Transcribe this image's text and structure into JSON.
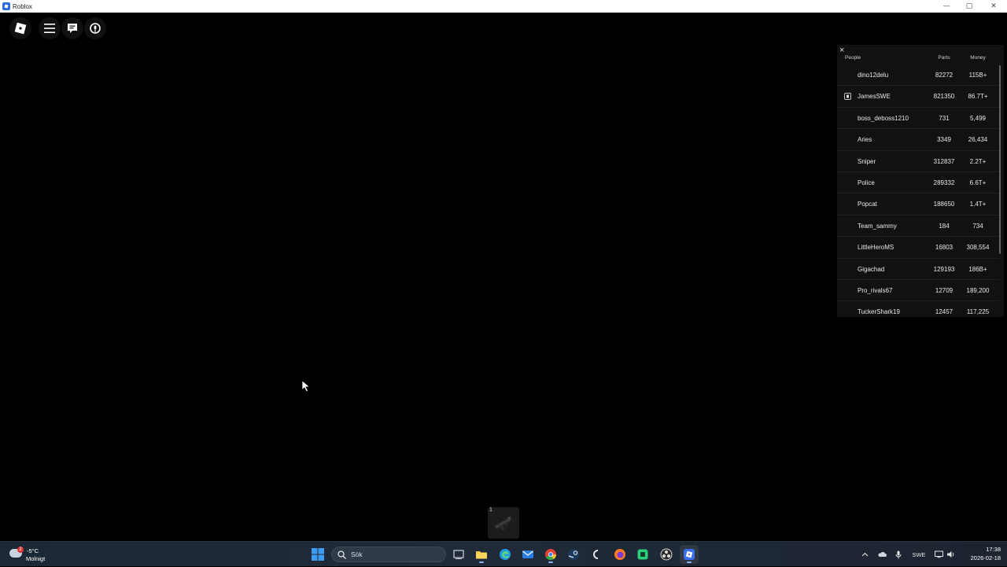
{
  "window": {
    "title": "Roblox",
    "controls": {
      "minimize": "—",
      "maximize": "▢",
      "close": "✕"
    }
  },
  "game_ui": {
    "top_buttons": [
      "roblox-menu-icon",
      "hamburger-icon",
      "chat-icon",
      "voice-icon"
    ],
    "player_list": {
      "close_label": "×",
      "headers": {
        "people": "People",
        "parts": "Parts",
        "money": "Money"
      },
      "players": [
        {
          "name": "dino12delu",
          "parts": "82272",
          "money": "115B+"
        },
        {
          "name": "JamesSWE",
          "parts": "821350",
          "money": "86.7T+",
          "icon": "friend-icon"
        },
        {
          "name": "boss_deboss1210",
          "parts": "731",
          "money": "5,499"
        },
        {
          "name": "Aries",
          "parts": "3349",
          "money": "26,434"
        },
        {
          "name": "Sniper",
          "parts": "312837",
          "money": "2.2T+"
        },
        {
          "name": "Police",
          "parts": "289332",
          "money": "6.6T+"
        },
        {
          "name": "Popcat",
          "parts": "188650",
          "money": "1.4T+"
        },
        {
          "name": "Team_sammy",
          "parts": "184",
          "money": "734"
        },
        {
          "name": "LittleHeroMS",
          "parts": "16803",
          "money": "308,554"
        },
        {
          "name": "Gigachad",
          "parts": "129193",
          "money": "186B+"
        },
        {
          "name": "Pro_rivals67",
          "parts": "12709",
          "money": "189,200"
        },
        {
          "name": "TuckerShark19",
          "parts": "12457",
          "money": "117,225"
        }
      ]
    },
    "hotbar": {
      "slot_number": "1",
      "item_icon": "gun-icon"
    }
  },
  "taskbar": {
    "weather": {
      "badge": "2",
      "temperature": "-5°C",
      "condition": "Molnigt"
    },
    "search_placeholder": "Sök",
    "tray": {
      "language": "SWE"
    },
    "clock": {
      "time": "17:38",
      "date": "2026-02-18"
    }
  }
}
